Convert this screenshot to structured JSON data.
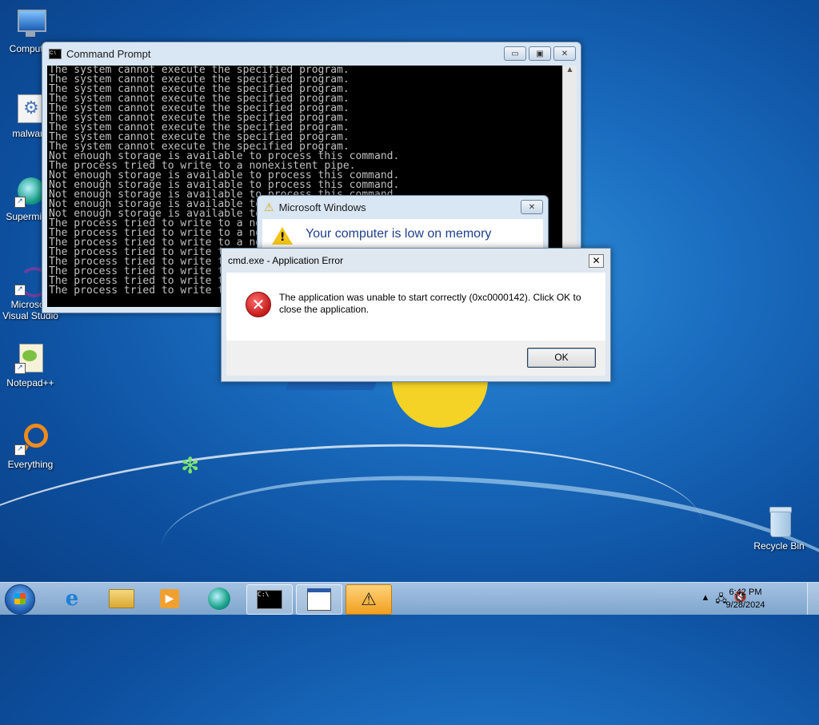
{
  "desktop": {
    "icons": [
      {
        "label": "Computer",
        "icon": "computer-icon"
      },
      {
        "label": "malware",
        "icon": "settings-exe-icon"
      },
      {
        "label": "Supermium",
        "icon": "browser-icon"
      },
      {
        "label": "Microsoft Visual Studio",
        "icon": "visual-studio-icon"
      },
      {
        "label": "Notepad++",
        "icon": "notepadpp-icon"
      },
      {
        "label": "Everything",
        "icon": "everything-search-icon"
      },
      {
        "label": "Recycle Bin",
        "icon": "recycle-bin-icon"
      }
    ]
  },
  "cmd_window": {
    "title": "Command Prompt",
    "lines": [
      "The system cannot execute the specified program.",
      "The system cannot execute the specified program.",
      "The system cannot execute the specified program.",
      "The system cannot execute the specified program.",
      "The system cannot execute the specified program.",
      "The system cannot execute the specified program.",
      "The system cannot execute the specified program.",
      "The system cannot execute the specified program.",
      "The system cannot execute the specified program.",
      "Not enough storage is available to process this command.",
      "The process tried to write to a nonexistent pipe.",
      "Not enough storage is available to process this command.",
      "Not enough storage is available to process this command.",
      "Not enough storage is available to process this command.",
      "Not enough storage is available to process this command.",
      "Not enough storage is available to process this command.",
      "The process tried to write to a nonexistent pipe.",
      "The process tried to write to a nonexistent pipe.",
      "The process tried to write to a nonexistent pipe.",
      "The process tried to write to a nonexistent pipe.",
      "The process tried to write to a nonexistent pipe.",
      "The process tried to write to a nonexistent pipe.",
      "The process tried to write to a nonexistent pipe.",
      "The process tried to write to a nonexistent pipe."
    ]
  },
  "lowmem_dialog": {
    "title": "Microsoft Windows",
    "message": "Your computer is low on memory"
  },
  "error_dialog": {
    "title": "cmd.exe - Application Error",
    "message": "The application was unable to start correctly (0xc0000142). Click OK to close the application.",
    "ok_label": "OK"
  },
  "taskbar": {
    "items": [
      {
        "name": "internet-explorer-icon",
        "glyph": "e"
      },
      {
        "name": "file-explorer-icon",
        "glyph": "📁"
      },
      {
        "name": "media-player-icon",
        "glyph": "▶"
      },
      {
        "name": "supermium-icon",
        "glyph": "◉"
      },
      {
        "name": "cmd-icon",
        "glyph": "C:\\"
      },
      {
        "name": "window-icon",
        "glyph": "▤"
      },
      {
        "name": "warning-icon",
        "glyph": "⚠"
      }
    ],
    "time": "6:42 PM",
    "date": "9/28/2024"
  },
  "colors": {
    "desktop_blue": "#1a6cbf",
    "error_red": "#c21b1b",
    "warning_yellow": "#f0c419",
    "dialog_text_blue": "#1e3f8b"
  }
}
